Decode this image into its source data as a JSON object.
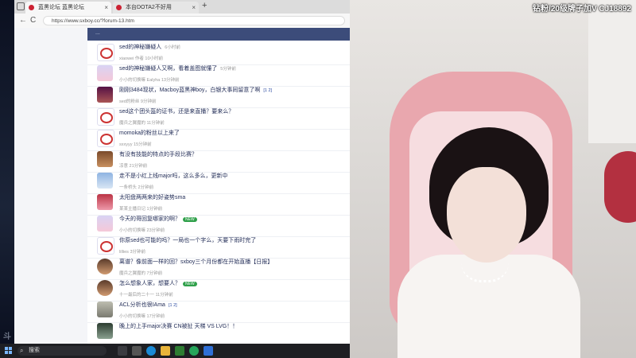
{
  "browser": {
    "tabs": [
      {
        "label": "蓝黑论坛 蓝黑论坛"
      },
      {
        "label": "本台DOTA2不好用"
      }
    ],
    "new_tab": "+",
    "back": "←",
    "reload": "C",
    "url": "https://www.sxboy.cc/?forum-13.htm"
  },
  "forum": {
    "banner": "...",
    "threads": [
      {
        "title": "sed的神秘嫌疑人",
        "time": "6小时前",
        "meta": "xiaowei 作者  10小时前",
        "avatar": "logo"
      },
      {
        "title": "sed的神秘嫌疑人又啊，看着盖图就懂了",
        "time": "5分钟前",
        "meta": "小小的切换嘛  Ealyha  13分钟前",
        "avatar": "anime"
      },
      {
        "title": "刚刚3484现状，Macboy蓝黑神boy，白银大事同留意了啊",
        "time": "",
        "meta": "sed的粉丝  9分钟前",
        "avatar": "dark",
        "pages": "[1 2]"
      },
      {
        "title": "sed这个团头盔的证书，还是来直播？要来么？",
        "time": "",
        "meta": "魔兵之翼魔的  11分钟前",
        "avatar": "logo"
      },
      {
        "title": "momoka的粉丝以上来了",
        "time": "",
        "meta": "sxxyyy  15分钟前",
        "avatar": "logo"
      },
      {
        "title": "有没有技能的特点的手段比赛？",
        "time": "",
        "meta": "凉意  21分钟前",
        "avatar": "brown"
      },
      {
        "title": "走不是小红上线major吗，这么多么，更新中",
        "time": "",
        "meta": "一条桥头  2分钟前",
        "avatar": "sky"
      },
      {
        "title": "太阳盘两两来的好姿势sma",
        "time": "",
        "meta": "某某主播日记  1分钟前",
        "avatar": "girl"
      },
      {
        "title": "今天的哥回复哪家的啊？",
        "time": "",
        "meta": "小小的切换嘛  23分钟前",
        "avatar": "anime",
        "badge": "NEW"
      },
      {
        "title": "你原sed也可能的吗？一局也一个字么，天要下雨时完了",
        "time": "",
        "meta": "lillies  3分钟前",
        "avatar": "logo"
      },
      {
        "title": "离谱？像前面一样的回？sxboy三个月份都在开始直播【日报】",
        "time": "",
        "meta": "魔兵之翼魔的  7分钟前",
        "avatar": "face"
      },
      {
        "title": "怎么想象人家，想要人？",
        "time": "",
        "meta": "十一最后的二十一  11分钟前",
        "avatar": "face",
        "badge": "NEW"
      },
      {
        "title": "ACL分析也很IAma",
        "time": "",
        "meta": "小小的切换嘛  17分钟前",
        "avatar": "cat",
        "pages": "[1 2]"
      },
      {
        "title": "晚上的上手major决赛 CN被扯 天梯 VS LVG！！",
        "time": "",
        "meta": "",
        "avatar": "mountain"
      }
    ]
  },
  "taskbar": {
    "search_placeholder": "搜索",
    "clock": ""
  },
  "cam": {
    "caption": "钻粉/20级牌子加V CJ18892"
  },
  "desktop": {
    "watermark": "斗鱼"
  }
}
